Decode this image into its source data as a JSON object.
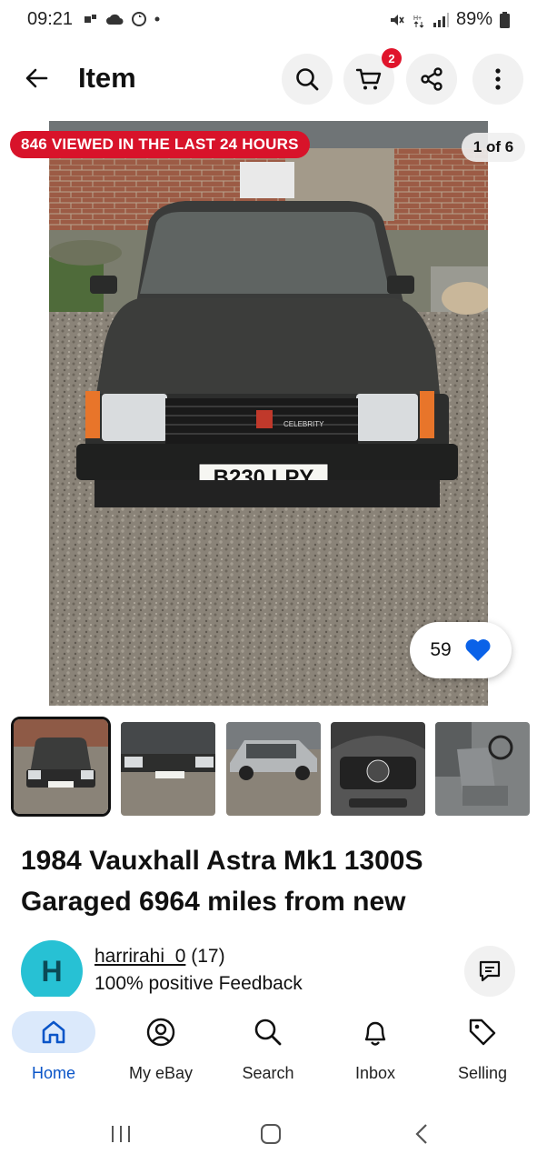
{
  "status_bar": {
    "time": "09:21",
    "battery": "89%"
  },
  "app_bar": {
    "title": "Item",
    "cart_count": "2"
  },
  "hero": {
    "viewed_badge": "846 VIEWED IN THE LAST 24 HOURS",
    "counter": "1 of 6",
    "like_count": "59",
    "plate": "B230 LPY",
    "grille_text": "CELEBRITY"
  },
  "thumbnails": [
    {
      "label": "front view"
    },
    {
      "label": "front close"
    },
    {
      "label": "side view"
    },
    {
      "label": "dashboard"
    },
    {
      "label": "interior seats"
    }
  ],
  "listing": {
    "title": "1984 Vauxhall Astra Mk1 1300S Garaged 6964 miles from new"
  },
  "seller": {
    "avatar_letter": "H",
    "username": "harrirahi_0",
    "score": "(17)",
    "feedback": "100% positive Feedback"
  },
  "bottom_nav": [
    {
      "label": "Home",
      "icon": "home-icon",
      "active": true
    },
    {
      "label": "My eBay",
      "icon": "user-icon",
      "active": false
    },
    {
      "label": "Search",
      "icon": "search-icon",
      "active": false
    },
    {
      "label": "Inbox",
      "icon": "bell-icon",
      "active": false
    },
    {
      "label": "Selling",
      "icon": "tag-icon",
      "active": false
    }
  ],
  "colors": {
    "accent_blue": "#0a55c8",
    "badge_red": "#d8132a",
    "avatar_teal": "#27c1d4"
  }
}
